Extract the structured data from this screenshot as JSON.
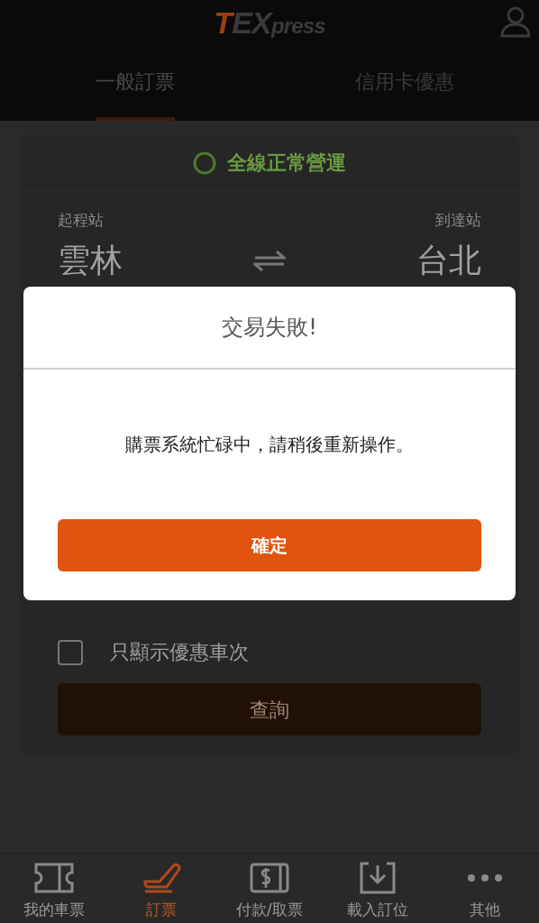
{
  "header": {
    "logo": [
      "T",
      "EX",
      "press"
    ]
  },
  "tabs": [
    {
      "label": "一般訂票",
      "selected": true
    },
    {
      "label": "信用卡優惠",
      "selected": false
    }
  ],
  "status": {
    "text": "全線正常營運"
  },
  "stations": {
    "from_label": "起程站",
    "from": "雲林",
    "to_label": "到達站",
    "to": "台北"
  },
  "discount_only": {
    "label": "只顯示優惠車次",
    "checked": false
  },
  "search_button": "查詢",
  "bottom_nav": [
    {
      "label": "我的車票",
      "selected": false
    },
    {
      "label": "訂票",
      "selected": true
    },
    {
      "label": "付款/取票",
      "selected": false
    },
    {
      "label": "載入訂位",
      "selected": false
    },
    {
      "label": "其他",
      "selected": false
    }
  ],
  "dialog": {
    "title": "交易失敗!",
    "message": "購票系統忙碌中，請稍後重新操作。",
    "button": "確定"
  }
}
